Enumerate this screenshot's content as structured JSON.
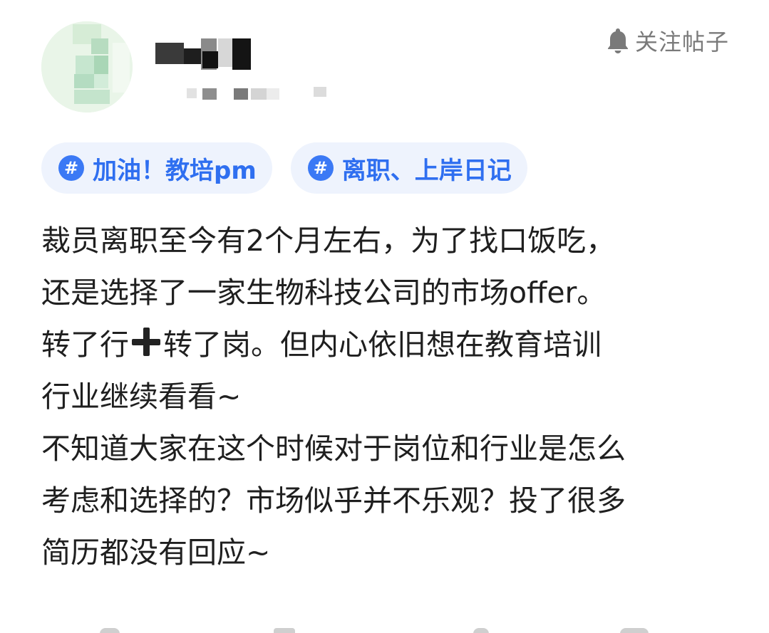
{
  "header": {
    "follow_label": "关注帖子",
    "follow_icon": "bell-icon"
  },
  "tags": [
    {
      "label": "加油！教培pm",
      "icon": "hashtag-icon"
    },
    {
      "label": "离职、上岸日记",
      "icon": "hashtag-icon"
    }
  ],
  "post": {
    "line1": "裁员离职至今有2个月左右，为了找口饭吃，",
    "line2": "还是选择了一家生物科技公司的市场offer。",
    "line3a": "转了行",
    "line3b": "转了岗。但内心依旧想在教育培训",
    "line4": "行业继续看看~",
    "line5": "不知道大家在这个时候对于岗位和行业是怎么",
    "line6": "考虑和选择的？市场似乎并不乐观？投了很多",
    "line7": "简历都没有回应~"
  },
  "colors": {
    "tag_bg": "#eef3fd",
    "tag_text": "#2f6ff0",
    "tag_icon": "#3b79f5",
    "body_text": "#1f1f1f",
    "muted": "#7a7a7a"
  }
}
